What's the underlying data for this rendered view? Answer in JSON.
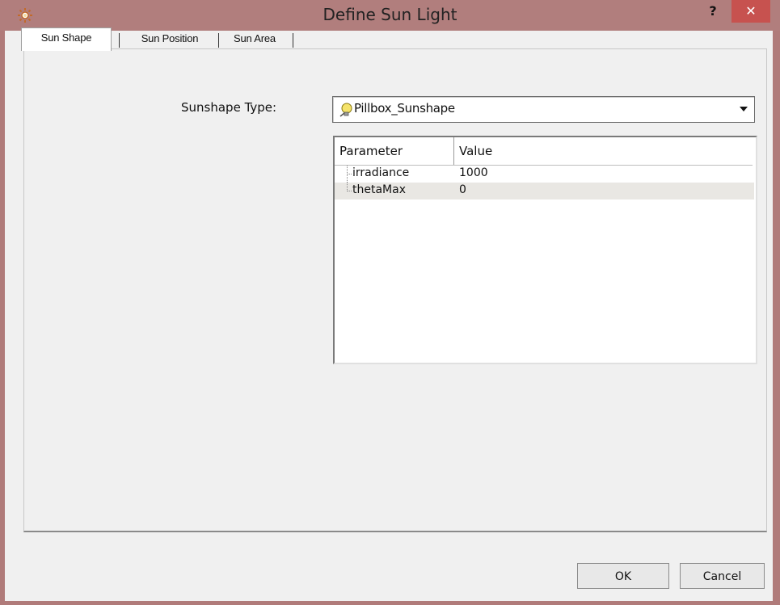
{
  "window": {
    "title": "Define Sun Light",
    "help_label": "?",
    "close_label": "✕",
    "app_icon": "sun-icon"
  },
  "tabs": [
    {
      "label": "Sun Shape",
      "active": true
    },
    {
      "label": "Sun Position",
      "active": false
    },
    {
      "label": "Sun Area",
      "active": false
    }
  ],
  "sunshape": {
    "label": "Sunshape Type:",
    "selected": "Pillbox_Sunshape",
    "selected_icon": "lightbulb-icon"
  },
  "parameters": {
    "columns": [
      "Parameter",
      "Value"
    ],
    "rows": [
      {
        "name": "irradiance",
        "value": "1000"
      },
      {
        "name": "thetaMax",
        "value": "0"
      }
    ]
  },
  "buttons": {
    "ok": "OK",
    "cancel": "Cancel"
  },
  "colors": {
    "titlebar": "#b17e7d",
    "close_button": "#c7524f"
  }
}
